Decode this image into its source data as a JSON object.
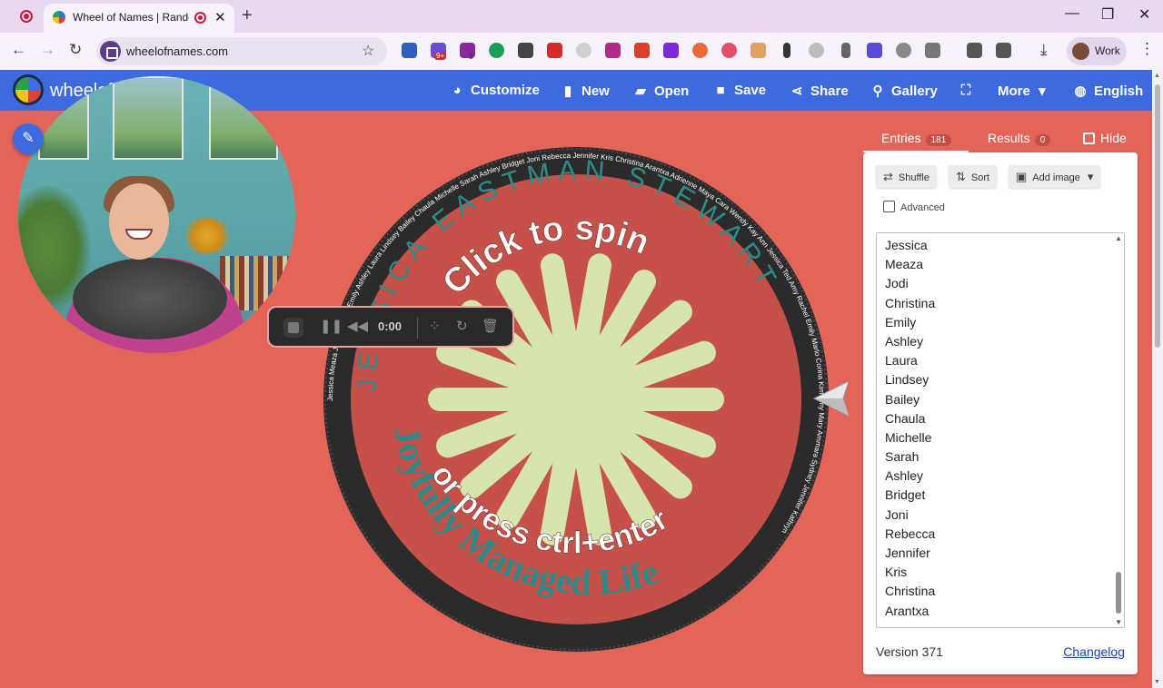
{
  "browser": {
    "tab_title": "Wheel of Names | Random",
    "url": "wheelofnames.com",
    "profile_label": "Work",
    "extension_badge_1": "9+",
    "extension_badge_2": "3"
  },
  "app": {
    "logo_text": "wheelof",
    "menu": [
      {
        "label": "Customize",
        "icon": "palette-icon"
      },
      {
        "label": "New",
        "icon": "file-icon"
      },
      {
        "label": "Open",
        "icon": "folder-open-icon"
      },
      {
        "label": "Save",
        "icon": "floppy-icon"
      },
      {
        "label": "Share",
        "icon": "share-icon"
      },
      {
        "label": "Gallery",
        "icon": "search-icon"
      },
      {
        "label": "",
        "icon": "fullscreen-icon"
      },
      {
        "label": "More",
        "icon": "chevron-down-icon"
      },
      {
        "label": "English",
        "icon": "globe-icon"
      }
    ]
  },
  "wheel": {
    "spin_text_top": "Click to spin",
    "spin_text_bottom": "or press ctrl+enter",
    "big_name_1": "Joyfully Managed Life",
    "big_name_2": "JESSICA EASTMAN STEWART",
    "ring_names": "Jessica Meaza Jodi Christina Emily Ashley Laura Lindsey Bailey Chaula Michelle Sarah Ashley Bridget Joni Rebecca Jennifer Kris Christina Arantxa Adrienne Maya Cara Wendy Kay Ann Jessica Ted Amy Rachel Emily Marlo Corina Kim Amy Mary Ammara Sydney Jennifer Kathryn",
    "colors": {
      "rim": "#2b2b2b",
      "face": "#c65149",
      "hub_text": "#bde0b9",
      "spokes": "#d6e4ae",
      "big_text": "#2f8a89"
    }
  },
  "recorder": {
    "time": "0:00"
  },
  "panel": {
    "tabs": {
      "entries_label": "Entries",
      "entries_count": "181",
      "results_label": "Results",
      "results_count": "0",
      "hide_label": "Hide"
    },
    "buttons": {
      "shuffle": "Shuffle",
      "sort": "Sort",
      "add_image": "Add image"
    },
    "advanced_label": "Advanced",
    "entries": [
      "Jessica",
      "Meaza",
      "Jodi",
      "Christina",
      "Emily",
      "Ashley",
      "Laura",
      "Lindsey",
      "Bailey",
      "Chaula",
      "Michelle",
      "Sarah",
      "Ashley",
      "Bridget",
      "Joni",
      "Rebecca",
      "Jennifer",
      "Kris",
      "Christina",
      "Arantxa"
    ],
    "version": "Version 371",
    "changelog": "Changelog"
  }
}
